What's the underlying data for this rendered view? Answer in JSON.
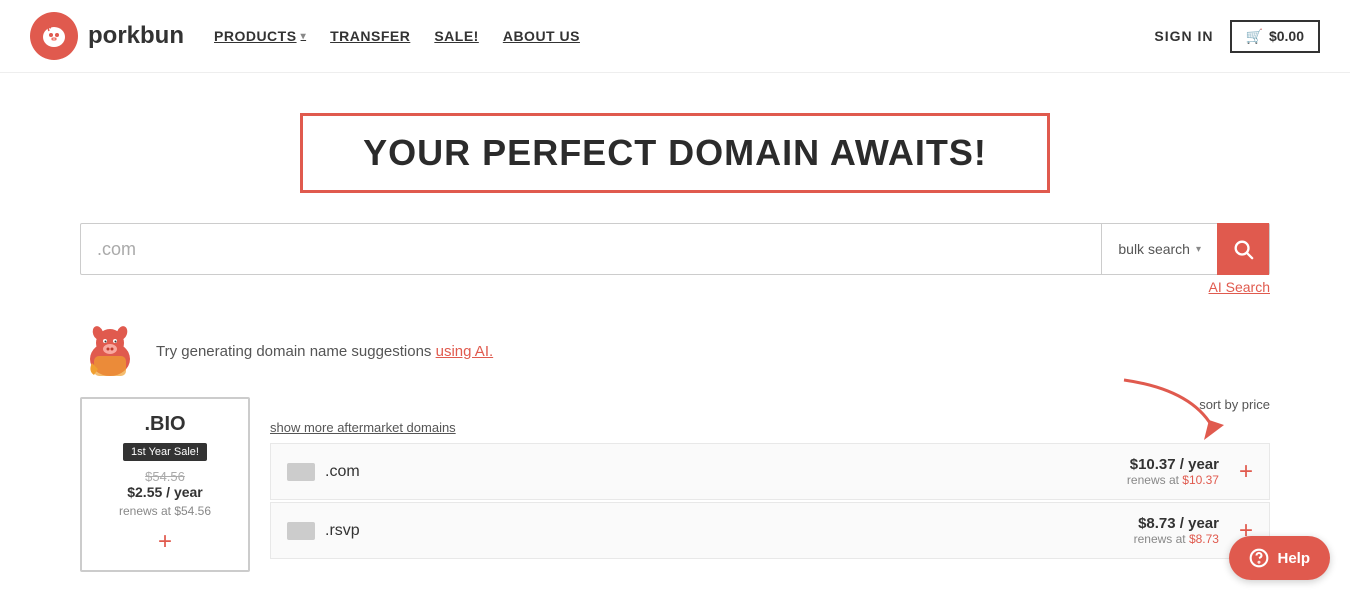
{
  "nav": {
    "logo_text": "porkbun",
    "links": [
      {
        "label": "PRODUCTS",
        "has_arrow": true
      },
      {
        "label": "TRANSFER"
      },
      {
        "label": "SALE!"
      },
      {
        "label": "ABOUT US"
      }
    ],
    "sign_in": "SIGN IN",
    "cart_label": "$0.00"
  },
  "hero": {
    "title": "YOUR PERFECT DOMAIN AWAITS!"
  },
  "search": {
    "input_placeholder": ".com",
    "input_value": ".com",
    "bulk_search_label": "bulk search",
    "search_button_label": "Search",
    "ai_search_label": "AI Search"
  },
  "ai_suggest": {
    "text": "Try generating domain name suggestions ",
    "link_text": "using AI."
  },
  "results": {
    "sort_label": "sort by price",
    "show_more_label": "show more aftermarket domains",
    "bio_card": {
      "tld": ".BIO",
      "badge": "1st Year Sale!",
      "old_price": "$54.56",
      "new_price": "$2.55 / year",
      "renew": "renews at $54.56",
      "add": "+"
    },
    "domains": [
      {
        "name": ".com",
        "price": "$10.37 / year",
        "renew": "renews at $10.37",
        "add": "+"
      },
      {
        "name": ".rsvp",
        "price": "$8.73 / year",
        "renew": "renews at $8.73",
        "add": "+"
      }
    ]
  },
  "help": {
    "label": "Help"
  }
}
